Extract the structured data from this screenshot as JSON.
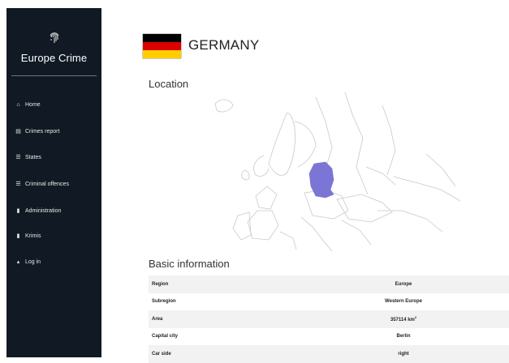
{
  "sidebar": {
    "logo_icon": "fingerprint-icon",
    "brand": "Europe Crime",
    "items": [
      {
        "label": "Home",
        "icon": "home-icon",
        "glyph": "⌂"
      },
      {
        "label": "Crimes report",
        "icon": "report-icon",
        "glyph": "▤"
      },
      {
        "label": "States",
        "icon": "list-icon",
        "glyph": "☰"
      },
      {
        "label": "Criminal offences",
        "icon": "list-icon",
        "glyph": "☰"
      },
      {
        "label": "Administration",
        "icon": "file-icon",
        "glyph": "▮"
      },
      {
        "label": "Krimis",
        "icon": "file-icon",
        "glyph": "▮"
      },
      {
        "label": "Log in",
        "icon": "user-icon",
        "glyph": "▴"
      }
    ]
  },
  "header": {
    "country": "GERMANY",
    "flag_colors": [
      "#000000",
      "#dd0000",
      "#ffce00"
    ]
  },
  "location": {
    "title": "Location",
    "highlight_color": "#7b75d6"
  },
  "basic_info": {
    "title": "Basic information",
    "rows": [
      {
        "key": "Region",
        "value": "Europe"
      },
      {
        "key": "Subregion",
        "value": "Western Europe"
      },
      {
        "key": "Area",
        "value": "357114 km",
        "sup": "2"
      },
      {
        "key": "Capital city",
        "value": "Berlin"
      },
      {
        "key": "Car side",
        "value": "right"
      }
    ]
  }
}
